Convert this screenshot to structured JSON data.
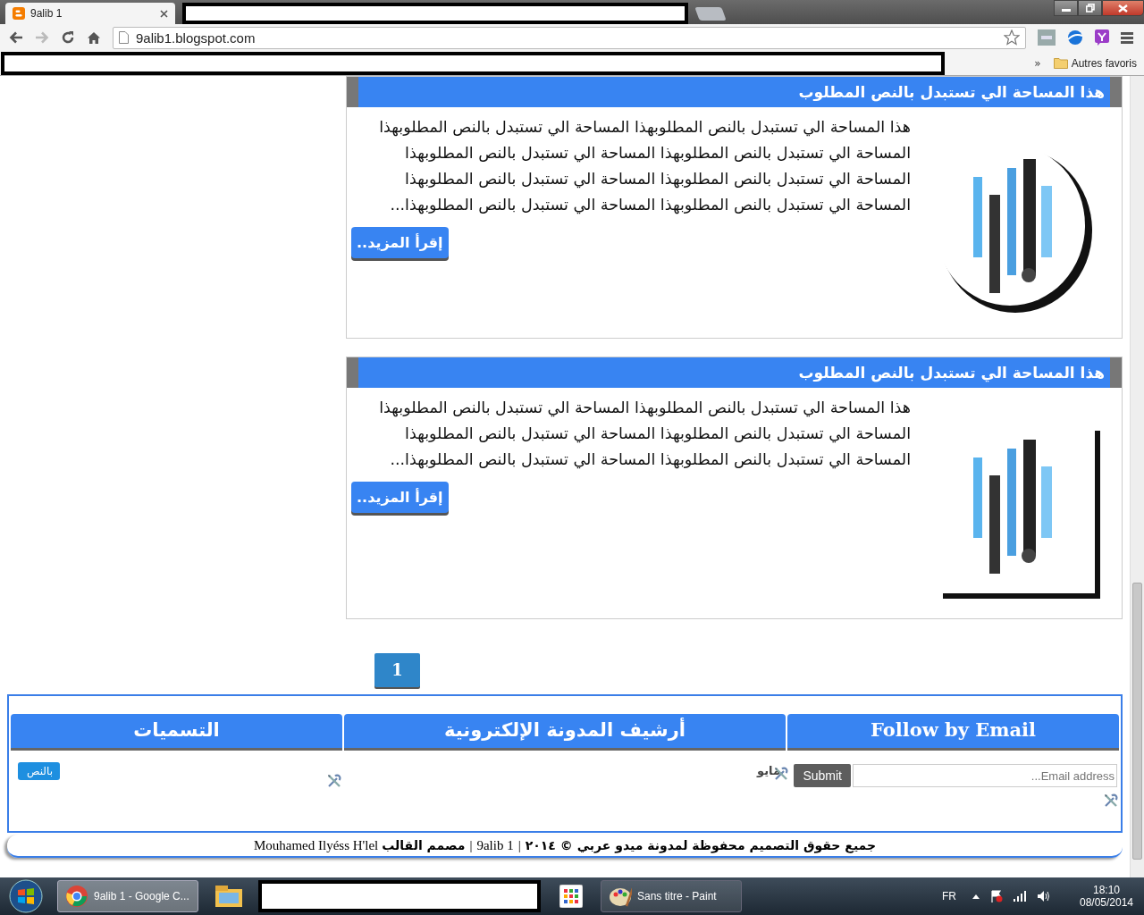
{
  "browser": {
    "tabs": [
      {
        "title": "9alib 1",
        "selected": true
      }
    ],
    "url": "9alib1.blogspot.com",
    "bookmarks": {
      "overflow": "»",
      "folder": "Autres favoris"
    }
  },
  "posts": [
    {
      "title": "هذا المساحة الي تستبدل بالنص المطلوب",
      "body": "هذا المساحة الي تستبدل بالنص المطلوبهذا المساحة الي تستبدل بالنص المطلوبهذا المساحة الي تستبدل بالنص المطلوبهذا المساحة الي تستبدل بالنص المطلوبهذا المساحة الي تستبدل بالنص المطلوبهذا المساحة الي تستبدل بالنص المطلوبهذا المساحة الي تستبدل بالنص المطلوبهذا المساحة الي تستبدل بالنص المطلوبهذا...",
      "read_more": "إقرأ المزيد..",
      "kind": "round"
    },
    {
      "title": "هذا المساحة الي تستبدل بالنص المطلوب",
      "body": "هذا المساحة الي تستبدل بالنص المطلوبهذا المساحة الي تستبدل بالنص المطلوبهذا المساحة الي تستبدل بالنص المطلوبهذا المساحة الي تستبدل بالنص المطلوبهذا المساحة الي تستبدل بالنص المطلوبهذا المساحة الي تستبدل بالنص المطلوبهذا...",
      "read_more": "إقرأ المزيد..",
      "kind": "square"
    }
  ],
  "pagination": [
    {
      "label": "1",
      "selected": true
    }
  ],
  "widgets": [
    {
      "kind": "email",
      "title": "Follow by Email",
      "placeholder": "Email address...",
      "submit": "Submit"
    },
    {
      "kind": "archive",
      "title": "أرشيف المدونة الإلكترونية",
      "month": "مايو"
    },
    {
      "kind": "labels",
      "title": "التسميات",
      "tags": [
        {
          "label": "بالنص"
        }
      ]
    }
  ],
  "footer": [
    {
      "kind": "arabic",
      "text": "جميع حقوق التصميم محفوظة لمدونة ميدو عربي © ٢٠١٤"
    },
    {
      "kind": "separator",
      "text": "|"
    },
    {
      "kind": "latin",
      "text": "9alib 1"
    },
    {
      "kind": "separator",
      "text": "|"
    },
    {
      "kind": "arabic",
      "text": "مصمم القالب"
    },
    {
      "kind": "latin",
      "text": "Mouhamed Ilyéss H'lel"
    }
  ],
  "taskbar": {
    "browser_window": {
      "label": "9alib 1 - Google C...",
      "selected": true
    },
    "paint_window": {
      "label": "Sans titre - Paint",
      "selected": false
    },
    "language": "FR",
    "time": "18:10",
    "date": "08/05/2014"
  }
}
